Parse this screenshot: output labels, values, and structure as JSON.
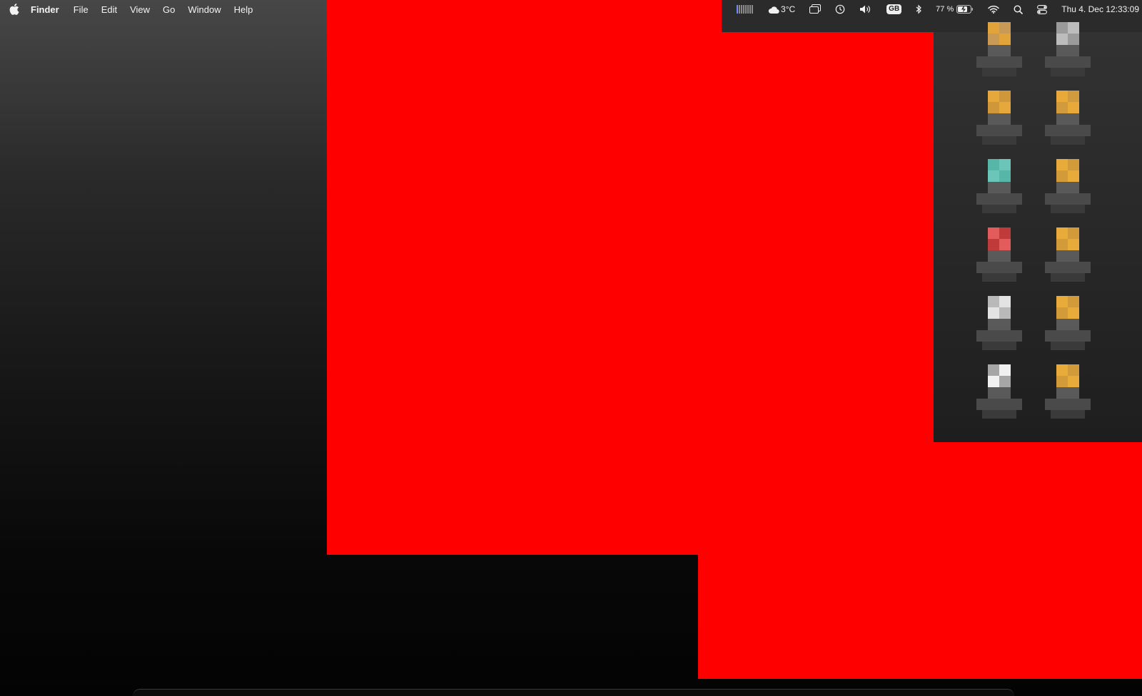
{
  "menubar": {
    "app_name": "Finder",
    "items": [
      "File",
      "Edit",
      "View",
      "Go",
      "Window",
      "Help"
    ]
  },
  "status": {
    "weather": "3°C",
    "input_source": "GB",
    "battery_percent": "77 %",
    "clock": "Thu 4. Dec  12:33:09"
  },
  "desktop_icons": [
    {
      "color": "#e0a43a",
      "highlight": "#c99a55"
    },
    {
      "color": "#9a9a9a",
      "highlight": "#bcbcbc"
    },
    {
      "color": "#e6a83c",
      "highlight": "#cf963a"
    },
    {
      "color": "#e8a93a",
      "highlight": "#d19a3c"
    },
    {
      "color": "#56b7a8",
      "highlight": "#6cc6b8"
    },
    {
      "color": "#e8aa3a",
      "highlight": "#d39a39"
    },
    {
      "color": "#e45b5b",
      "highlight": "#c03a3a"
    },
    {
      "color": "#e8aa3a",
      "highlight": "#d39a39"
    },
    {
      "color": "#b9b9b9",
      "highlight": "#e3e3e3"
    },
    {
      "color": "#e8aa3a",
      "highlight": "#d39a39"
    },
    {
      "color": "#a6a6a6",
      "highlight": "#f0f0f0"
    },
    {
      "color": "#e8aa3a",
      "highlight": "#d39a39"
    }
  ],
  "colors": {
    "redaction": "#ff0000"
  }
}
